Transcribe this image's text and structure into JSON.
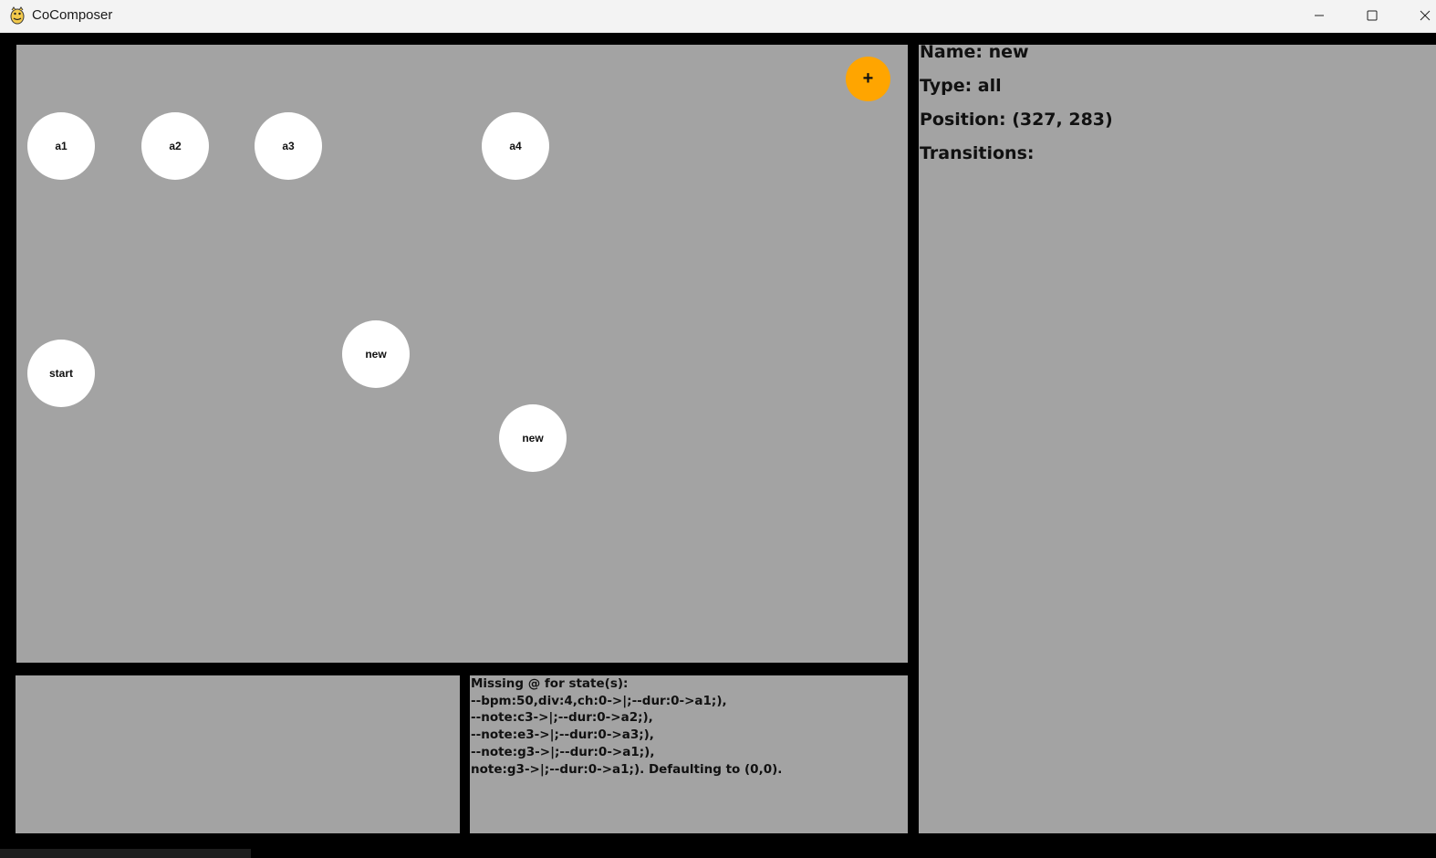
{
  "window": {
    "title": "CoComposer",
    "app_icon": "python-snake-icon",
    "controls": [
      "minimize-icon",
      "maximize-icon",
      "close-icon"
    ]
  },
  "colors": {
    "background": "#000000",
    "panel": "#a3a3a3",
    "node": "#ffffff",
    "add_button": "#ffa500"
  },
  "canvas": {
    "add_button_label": "+",
    "nodes": [
      {
        "label": "a1"
      },
      {
        "label": "a2"
      },
      {
        "label": "a3"
      },
      {
        "label": "a4"
      },
      {
        "label": "start"
      },
      {
        "label": "new"
      },
      {
        "label": "new"
      }
    ]
  },
  "info": {
    "name": "Name: new",
    "type": "Type: all",
    "position": "Position: (327, 283)",
    "transitions": "Transitions:"
  },
  "log": {
    "lines": [
      "Missing @ for state(s):",
      "--bpm:50,div:4,ch:0->|;--dur:0->a1;),",
      "--note:c3->|;--dur:0->a2;),",
      "--note:e3->|;--dur:0->a3;),",
      "--note:g3->|;--dur:0->a1;),",
      "note:g3->|;--dur:0->a1;). Defaulting to (0,0)."
    ]
  }
}
